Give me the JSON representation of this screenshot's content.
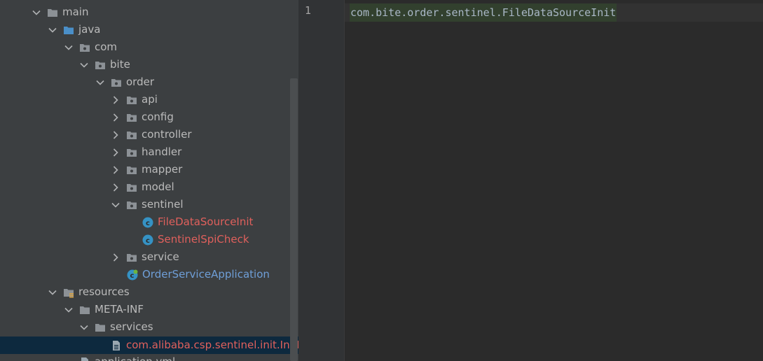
{
  "tree": {
    "items": [
      {
        "label": "main",
        "icon": "folder",
        "expanded": true
      },
      {
        "label": "java",
        "icon": "source-folder",
        "expanded": true
      },
      {
        "label": "com",
        "icon": "package",
        "expanded": true
      },
      {
        "label": "bite",
        "icon": "package",
        "expanded": true
      },
      {
        "label": "order",
        "icon": "package",
        "expanded": true
      },
      {
        "label": "api",
        "icon": "package",
        "expanded": false
      },
      {
        "label": "config",
        "icon": "package",
        "expanded": false
      },
      {
        "label": "controller",
        "icon": "package",
        "expanded": false
      },
      {
        "label": "handler",
        "icon": "package",
        "expanded": false
      },
      {
        "label": "mapper",
        "icon": "package",
        "expanded": false
      },
      {
        "label": "model",
        "icon": "package",
        "expanded": false
      },
      {
        "label": "sentinel",
        "icon": "package",
        "expanded": true
      },
      {
        "label": "FileDataSourceInit",
        "icon": "java-class",
        "status": "red"
      },
      {
        "label": "SentinelSpiCheck",
        "icon": "java-class",
        "status": "red"
      },
      {
        "label": "service",
        "icon": "package",
        "expanded": false
      },
      {
        "label": "OrderServiceApplication",
        "icon": "spring-boot-class",
        "status": "blue"
      },
      {
        "label": "resources",
        "icon": "resources-folder",
        "expanded": true
      },
      {
        "label": "META-INF",
        "icon": "folder",
        "expanded": true
      },
      {
        "label": "services",
        "icon": "folder",
        "expanded": true
      },
      {
        "label": "com.alibaba.csp.sentinel.init.InitFunc",
        "icon": "text-file",
        "status": "red",
        "selected": true
      },
      {
        "label": "application.yml",
        "icon": "yaml-file"
      }
    ]
  },
  "editor": {
    "line_number": "1",
    "code": "com.bite.order.sentinel.FileDataSourceInit"
  }
}
